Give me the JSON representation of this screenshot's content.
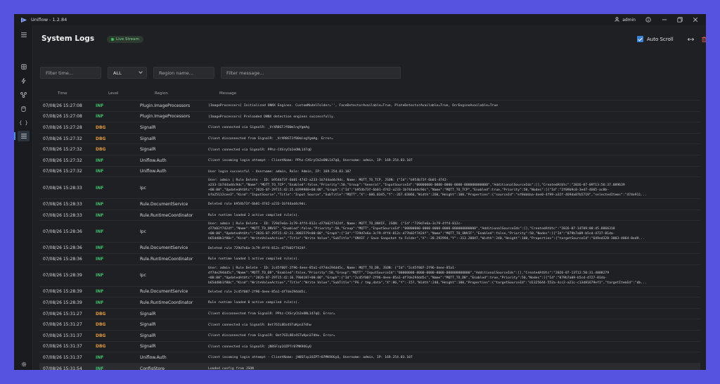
{
  "app": {
    "title": "Uniflow - 1.2.84",
    "user": "admin"
  },
  "page": {
    "title": "System Logs",
    "live_label": "Live Stream",
    "auto_scroll_label": "Auto Scroll"
  },
  "filters": {
    "time_placeholder": "Filter time...",
    "level_value": "ALL",
    "region_placeholder": "Region name...",
    "message_placeholder": "Filter message..."
  },
  "columns": {
    "time": "Time",
    "level": "Level",
    "region": "Region",
    "message": "Message"
  },
  "colors": {
    "accent": "#3a82d6",
    "info": "#3ec06b",
    "debug": "#e09b34",
    "live": "#3fc05a"
  },
  "icons": [
    "uniflow-logo-icon",
    "user-icon",
    "info-icon",
    "minimize-icon",
    "maximize-icon",
    "close-icon",
    "menu-icon",
    "dashboard-icon",
    "bolt-icon",
    "workflow-icon",
    "database-icon",
    "braces-icon",
    "logs-icon",
    "settings-icon",
    "checkbox-checked-icon",
    "collapse-icon",
    "trash-icon",
    "chevron-down-icon"
  ],
  "logs": [
    {
      "time": "07/08/26 15:27:08",
      "level": "INF",
      "region": "Plugin.ImageProcessors",
      "message": "[ImageProcessors] Initialized ONNX Engines. CustomModelFolder='', FaceDetectorAvailable=True, PlateDetectorAvailable=True, OcrEngineAvailable=True"
    },
    {
      "time": "07/08/26 15:27:08",
      "level": "INF",
      "region": "Plugin.ImageProcessors",
      "message": "[ImageProcessors] Preloaded ONNX detection engines successfully."
    },
    {
      "time": "07/08/26 15:27:28",
      "level": "DBG",
      "region": "SignalR",
      "message": "Client connected via SignalR: _VrXR8GTJfB0mlngYgmAg"
    },
    {
      "time": "07/08/26 15:27:32",
      "level": "DBG",
      "region": "SignalR",
      "message": "Client disconnected from SignalR: _VrXR8GTJfB0mlngYgmAg. Error="
    },
    {
      "time": "07/08/26 15:27:32",
      "level": "DBG",
      "region": "SignalR",
      "message": "Client connected via SignalR: PPhz-CXSryCb2eONL147qQ"
    },
    {
      "time": "07/08/26 15:27:32",
      "level": "INF",
      "region": "Uniflow.Auth",
      "message": "Client incoming login attempt - ClientName: PPhz-CXSryCb2eONL147qQ, Username: admin, IP: 169.254.83.107"
    },
    {
      "time": "07/08/26 15:27:32",
      "level": "INF",
      "region": "Uniflow.Auth",
      "message": "User login successful - Username: admin, Role: Admin, IP: 169.254.83.107"
    },
    {
      "time": "07/08/26 15:28:33",
      "level": "INF",
      "region": "Ipc",
      "message": "User: admin | Rule Delete - ID: b954b73f-6b01-4742-a233-1b744ad4c9dc, Name: MQTT_TO_TCP, JSON: {\"Id\":\"b954b73f-6b01-4742-\na233-1b744ad4c9dc\",\"Name\":\"MQTT_TO_TCP\",\"Enabled\":false,\"Priority\":50,\"Group\":\"General\",\"InputSourceId\":\"00000000-0000-0000-0000-000000000000\",\"AdditionalSourceIds\":[],\"CreatedAtUtc\":\"2026-07-09T13:56:37.089639\n+00:00\",\"UpdatedAtUtc\":\"2026-07-29T15:42:25.0399988+00:00\",\"Graph\":{\"Id\":\"b954b73f-6b01-4742-a233-1b744ad4c9dc\",\"Name\":\"MQTT_TO_TCP\",\"Enabled\":true,\"Priority\":50,\"Nodes\":[{\"Id\":\"2f09b9c0-3ed7-4665-ac8b-\nbfa25113cee3\",\"Kind\":\"InputSource\",\"Title\":\"Input Source\",\"SubTitle\":\"MQTT\",\"X\":-606.0345,\"Y\":-267.03066,\"Width\":260,\"Height\":100,\"Properties\":{\"sourceId\":\"ef0dddaa-4ee0-4f99-a32f-469da87b5719\",\"selectedItems\":\"474e911..."
    },
    {
      "time": "07/08/26 15:28:33",
      "level": "INF",
      "region": "Rule.DocumentService",
      "message": "Deleted rule b954b73f-6b01-4742-a233-1b744ad4c9dc."
    },
    {
      "time": "07/08/26 15:28:33",
      "level": "INF",
      "region": "Rule.RuntimeCoordinator",
      "message": "Rule runtime loaded 2 active compiled rule(s)."
    },
    {
      "time": "07/08/26 15:28:36",
      "level": "INF",
      "region": "Ipc",
      "message": "User: admin | Rule Delete - ID: 729d7e6a-3c79-4ff4-812c-d77b02f7424f, Name: MQTT_TO_ONVIF, JSON: {\"Id\":\"729d7e6a-3c79-4ff4-812c-\nd77b02f7424f\",\"Name\":\"MQTT_TO_ONVIF\",\"Enabled\":false,\"Priority\":50,\"Group\":\"MQTT\",\"InputSourceId\":\"00000000-0000-0000-0000-000000000000\",\"AdditionalSourceIds\":[],\"CreatedAtUtc\":\"2026-07-14T09:00:45.8866318\n+00:00\",\"UpdatedAtUtc\":\"2026-07-29T15:42:21.3082579+00:00\",\"Graph\":{\"Id\":\"729d7e6a-3c79-4ff4-812c-d77b02f7424f\",\"Name\":\"MQTT_TO_ONVIF\",\"Enabled\":false,\"Priority\":50,\"Nodes\":[{\"Id\":\"079b7a09-b5cd-4727-81da-\nb65dd8b1f80c\",\"Kind\":\"WriteValueAction\",\"Title\":\"Write Value\",\"SubTitle\":\"ONVIF / Save Snapshot to Folder\",\"X\":-28.292994,\"Y\":-313.20847,\"Width\":240,\"Height\":100,\"Properties\":{\"targetSourceId\":\"649ed328-3003-4064-8ed9..."
    },
    {
      "time": "07/08/26 15:28:36",
      "level": "INF",
      "region": "Rule.DocumentService",
      "message": "Deleted rule 729d7e6a-3c79-4ff4-812c-d77b02f7424f."
    },
    {
      "time": "07/08/26 15:28:36",
      "level": "INF",
      "region": "Rule.RuntimeCoordinator",
      "message": "Rule runtime loaded 1 active compiled rule(s)."
    },
    {
      "time": "07/08/26 15:28:39",
      "level": "INF",
      "region": "Ipc",
      "message": "User: admin | Rule Delete - ID: 2c45f007-2f96-4eee-85a1-df7de294dd5c, Name: MQTT_TO_DB, JSON: {\"Id\":\"2c45f007-2f96-4eee-85a1-\ndf7de294dd5c\",\"Name\":\"MQTT_TO_DB\",\"Enabled\":false,\"Priority\":50,\"Group\":\"MQTT\",\"InputSourceId\":\"00000000-0000-0000-0000-000000000000\",\"AdditionalSourceIds\":[],\"CreatedAtUtc\":\"2026-07-13T12:50:31.4088279\n+00:00\",\"UpdatedAtUtc\":\"2026-07-29T15:42:16.7904187+00:00\",\"Graph\":{\"Id\":\"2c45f007-2f96-4eee-85a1-df7de294dd5c\",\"Name\":\"MQTT_TO_DB\",\"Enabled\":true,\"Priority\":50,\"Nodes\":[{\"Id\":\"079b7a09-b5cd-4727-81da-\nb65dd8b1f80c\",\"Kind\":\"WriteValueAction\",\"Title\":\"Write Value\",\"SubTitle\":\"PG / tmp_data\",\"X\":86,\"Y\":-157,\"Width\":240,\"Height\":100,\"Properties\":{\"targetSourceId\":\"d1325644-552a-4cc2-a21c-c13d81679ef1\",\"targetItemId\":\"db..."
    },
    {
      "time": "07/08/26 15:28:39",
      "level": "INF",
      "region": "Rule.DocumentService",
      "message": "Deleted rule 2c45f007-2f96-4eee-85a1-df7de294dd5c."
    },
    {
      "time": "07/08/26 15:28:39",
      "level": "INF",
      "region": "Rule.RuntimeCoordinator",
      "message": "Rule runtime loaded 0 active compiled rule(s)."
    },
    {
      "time": "07/08/26 15:31:27",
      "level": "DBG",
      "region": "SignalR",
      "message": "Client disconnected from SignalR: PPhz-CXSryCb2eONL147qQ. Error="
    },
    {
      "time": "07/08/26 15:31:27",
      "level": "DBG",
      "region": "SignalR",
      "message": "Client connected via SignalR: 8et76IL8Dz4STuKpn37dhw"
    },
    {
      "time": "07/08/26 15:31:37",
      "level": "DBG",
      "region": "SignalR",
      "message": "Client disconnected from SignalR: 8et76IL8Dz4STuKpn37dhw. Error="
    },
    {
      "time": "07/08/26 15:31:37",
      "level": "DBG",
      "region": "SignalR",
      "message": "Client connected via SignalR: jN8SFzp1OZPTr07MK9OGyQ"
    },
    {
      "time": "07/08/26 15:31:37",
      "level": "INF",
      "region": "Uniflow.Auth",
      "message": "Client incoming login attempt - ClientName: jN8SFzp1OZPTr07MK9OGyQ, Username: admin, IP: 169.254.83.107"
    },
    {
      "time": "07/08/26 15:31:54",
      "level": "INF",
      "region": "ConfigStore",
      "message": "Loaded config from JSON"
    }
  ]
}
